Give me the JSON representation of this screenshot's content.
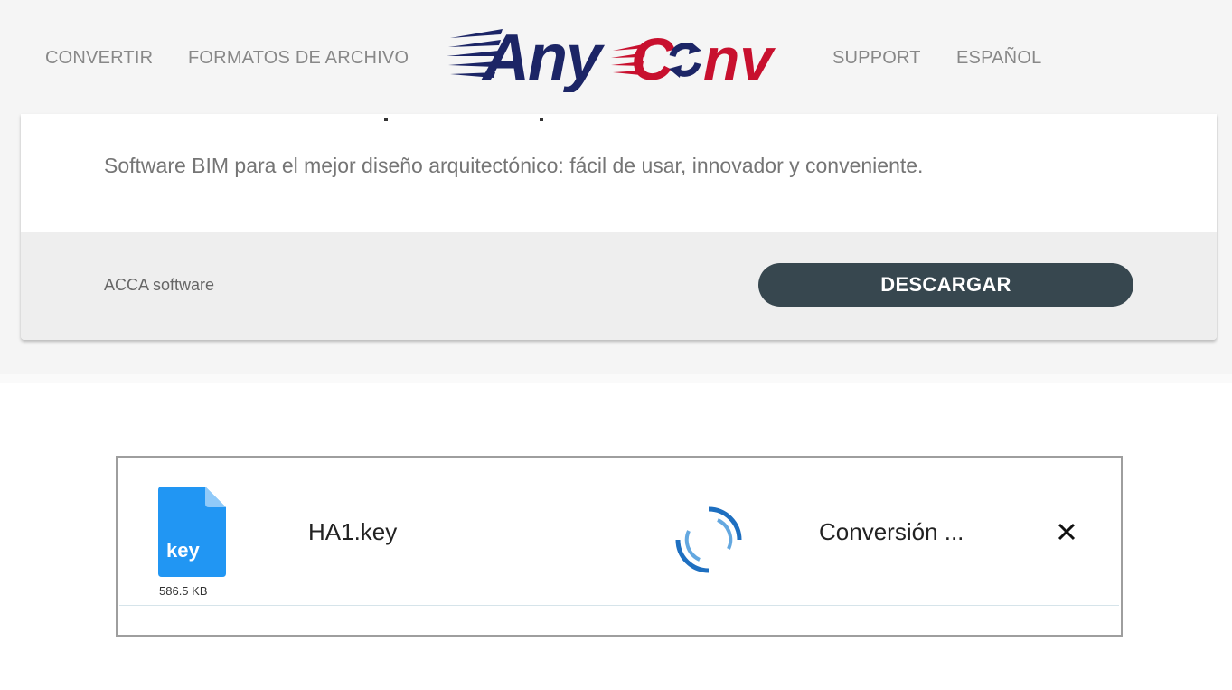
{
  "nav": {
    "convert": "CONVERTIR",
    "formats": "FORMATOS DE ARCHIVO",
    "support": "SUPPORT",
    "language": "ESPAÑOL"
  },
  "logo": {
    "part1": "Any",
    "part2": "C",
    "part3": "nv",
    "color_navy": "#1c2566",
    "color_red": "#c8102e"
  },
  "ad": {
    "description": "Software BIM para el mejor diseño arquitectónico: fácil de usar, innovador y conveniente.",
    "brand": "ACCA software",
    "button_label": "DESCARGAR",
    "button_color": "#37474f"
  },
  "file": {
    "icon_label": "key",
    "icon_color": "#2196f3",
    "size": "586.5 KB",
    "name": "HA1.key",
    "status": "Conversión ...",
    "spinner_color": "#1e6fc0"
  }
}
